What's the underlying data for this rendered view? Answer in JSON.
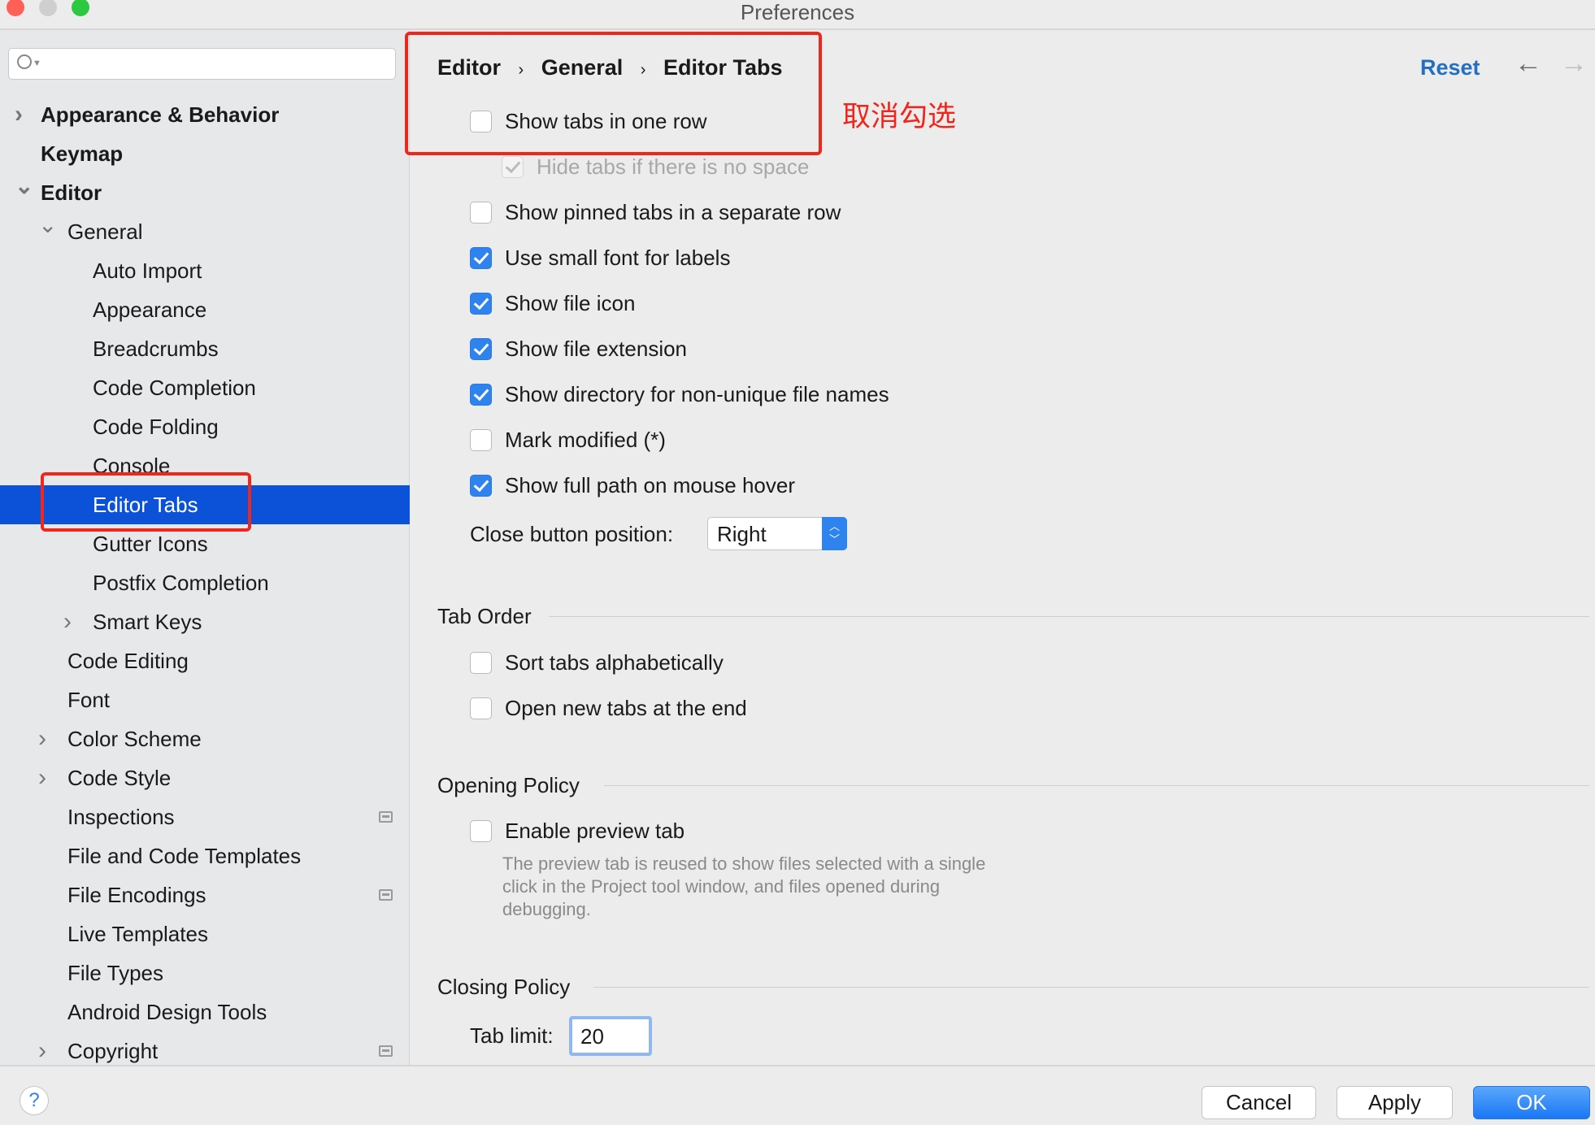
{
  "window": {
    "title": "Preferences"
  },
  "search": {
    "placeholder": ""
  },
  "sidebar": {
    "items": [
      {
        "label": "Appearance & Behavior",
        "level": 0,
        "bold": true,
        "chevron": "right"
      },
      {
        "label": "Keymap",
        "level": 0,
        "bold": true
      },
      {
        "label": "Editor",
        "level": 0,
        "bold": true,
        "chevron": "down"
      },
      {
        "label": "General",
        "level": 1,
        "chevron": "down"
      },
      {
        "label": "Auto Import",
        "level": 2
      },
      {
        "label": "Appearance",
        "level": 2
      },
      {
        "label": "Breadcrumbs",
        "level": 2
      },
      {
        "label": "Code Completion",
        "level": 2
      },
      {
        "label": "Code Folding",
        "level": 2
      },
      {
        "label": "Console",
        "level": 2
      },
      {
        "label": "Editor Tabs",
        "level": 2,
        "selected": true
      },
      {
        "label": "Gutter Icons",
        "level": 2
      },
      {
        "label": "Postfix Completion",
        "level": 2
      },
      {
        "label": "Smart Keys",
        "level": 2,
        "chevron": "right"
      },
      {
        "label": "Code Editing",
        "level": 1
      },
      {
        "label": "Font",
        "level": 1
      },
      {
        "label": "Color Scheme",
        "level": 1,
        "chevron": "right"
      },
      {
        "label": "Code Style",
        "level": 1,
        "chevron": "right"
      },
      {
        "label": "Inspections",
        "level": 1,
        "icon": "project-settings-icon"
      },
      {
        "label": "File and Code Templates",
        "level": 1
      },
      {
        "label": "File Encodings",
        "level": 1,
        "icon": "project-settings-icon"
      },
      {
        "label": "Live Templates",
        "level": 1
      },
      {
        "label": "File Types",
        "level": 1
      },
      {
        "label": "Android Design Tools",
        "level": 1
      },
      {
        "label": "Copyright",
        "level": 1,
        "chevron": "right",
        "icon": "project-settings-icon"
      }
    ]
  },
  "breadcrumb": [
    "Editor",
    "General",
    "Editor Tabs"
  ],
  "header": {
    "reset": "Reset"
  },
  "annotation": {
    "text": "取消勾选",
    "color": "#f0261c"
  },
  "options": [
    {
      "label": "Show tabs in one row",
      "checked": false
    },
    {
      "label": "Hide tabs if there is no space",
      "checked": true,
      "disabled": true,
      "indent": true
    },
    {
      "label": "Show pinned tabs in a separate row",
      "checked": false
    },
    {
      "label": "Use small font for labels",
      "checked": true
    },
    {
      "label": "Show file icon",
      "checked": true
    },
    {
      "label": "Show file extension",
      "checked": true
    },
    {
      "label": "Show directory for non-unique file names",
      "checked": true
    },
    {
      "label": "Mark modified (*)",
      "checked": false
    },
    {
      "label": "Show full path on mouse hover",
      "checked": true
    }
  ],
  "close_button": {
    "label": "Close button position:",
    "value": "Right"
  },
  "tab_order": {
    "title": "Tab Order",
    "options": [
      {
        "label": "Sort tabs alphabetically",
        "checked": false
      },
      {
        "label": "Open new tabs at the end",
        "checked": false
      }
    ]
  },
  "opening_policy": {
    "title": "Opening Policy",
    "option": {
      "label": "Enable preview tab",
      "checked": false
    },
    "description": [
      "The preview tab is reused to show files selected with a single",
      "click in the Project tool window, and files opened during",
      "debugging."
    ]
  },
  "closing_policy": {
    "title": "Closing Policy",
    "tab_limit_label": "Tab limit:",
    "tab_limit": "20"
  },
  "footer": {
    "help": "?",
    "cancel": "Cancel",
    "apply": "Apply",
    "ok": "OK"
  },
  "colors": {
    "accent": "#0b52d8",
    "checkbox": "#2f83ef",
    "link": "#2470c0",
    "highlight": "#f0261c"
  }
}
